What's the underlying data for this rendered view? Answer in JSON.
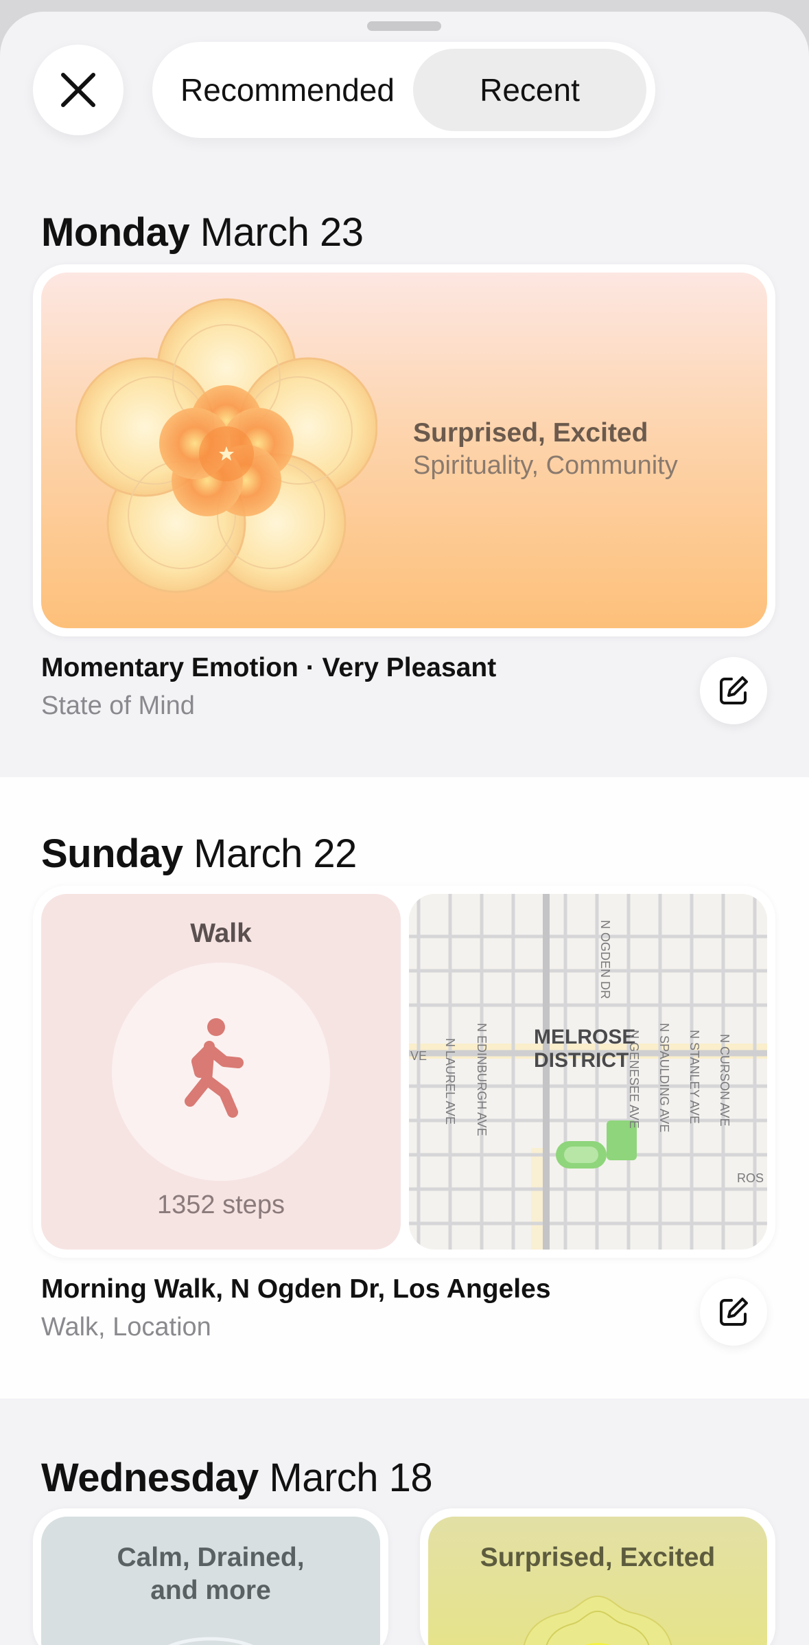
{
  "header": {
    "close_icon": "close-icon",
    "segments": {
      "recommended": "Recommended",
      "recent": "Recent"
    },
    "selected_segment": "Recent"
  },
  "sections": [
    {
      "day": "Monday",
      "date": "March 23",
      "mood": {
        "primary": "Surprised, Excited",
        "secondary": "Spirituality, Community"
      },
      "title": "Momentary Emotion · Very Pleasant",
      "subtitle": "State of Mind"
    },
    {
      "day": "Sunday",
      "date": "March 22",
      "walk": {
        "label": "Walk",
        "steps": "1352 steps"
      },
      "map": {
        "district": [
          "MELROSE",
          "DISTRICT"
        ],
        "streets": [
          "N OGDEN DR",
          "N LAUREL AVE",
          "N EDINBURGH AVE",
          "N GENESEE AVE",
          "N SPAULDING AVE",
          "N STANLEY AVE",
          "N CURSON AVE",
          "VE",
          "ROS"
        ]
      },
      "title": "Morning Walk, N Ogden Dr, Los Angeles",
      "subtitle": "Walk, Location"
    },
    {
      "day": "Wednesday",
      "date": "March 18",
      "cards": [
        {
          "label_line1": "Calm, Drained,",
          "label_line2": "and more"
        },
        {
          "label_line1": "Surprised, Excited",
          "label_line2": ""
        }
      ]
    }
  ],
  "colors": {
    "mood_gradient_top": "#fde7e2",
    "mood_gradient_bottom": "#fdc07a",
    "walk_accent": "#d97a74",
    "calm_card": "#d7dfe0",
    "excited_card": "#e3e29e"
  }
}
